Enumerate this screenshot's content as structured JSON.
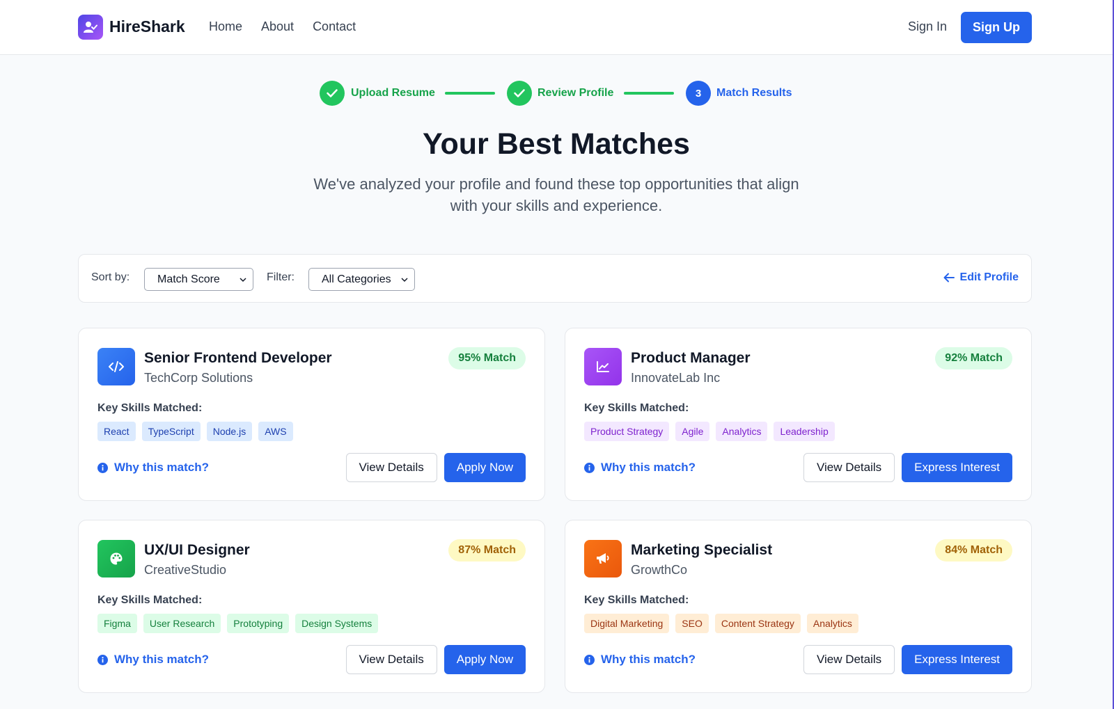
{
  "header": {
    "brand": "HireShark",
    "nav": [
      "Home",
      "About",
      "Contact"
    ],
    "sign_in": "Sign In",
    "sign_up": "Sign Up"
  },
  "steps": [
    {
      "label": "Upload Resume",
      "state": "done"
    },
    {
      "label": "Review Profile",
      "state": "done"
    },
    {
      "label": "Match Results",
      "state": "active",
      "number": "3"
    }
  ],
  "page": {
    "title": "Your Best Matches",
    "subtitle": "We've analyzed your profile and found these top opportunities that align with your skills and experience."
  },
  "toolbar": {
    "sort_label": "Sort by:",
    "sort_value": "Match Score",
    "filter_label": "Filter:",
    "filter_value": "All Categories",
    "edit_profile": "Edit Profile"
  },
  "jobs": [
    {
      "title": "Senior Frontend Developer",
      "company": "TechCorp Solutions",
      "match": "95% Match",
      "icon": "code-icon",
      "skills_label": "Key Skills Matched:",
      "skills": [
        "React",
        "TypeScript",
        "Node.js",
        "AWS"
      ],
      "why": "Why this match?",
      "secondary": "View Details",
      "primary": "Apply Now"
    },
    {
      "title": "Product Manager",
      "company": "InnovateLab Inc",
      "match": "92% Match",
      "icon": "chart-line-icon",
      "skills_label": "Key Skills Matched:",
      "skills": [
        "Product Strategy",
        "Agile",
        "Analytics",
        "Leadership"
      ],
      "why": "Why this match?",
      "secondary": "View Details",
      "primary": "Express Interest"
    },
    {
      "title": "UX/UI Designer",
      "company": "CreativeStudio",
      "match": "87% Match",
      "icon": "palette-icon",
      "skills_label": "Key Skills Matched:",
      "skills": [
        "Figma",
        "User Research",
        "Prototyping",
        "Design Systems"
      ],
      "why": "Why this match?",
      "secondary": "View Details",
      "primary": "Apply Now"
    },
    {
      "title": "Marketing Specialist",
      "company": "GrowthCo",
      "match": "84% Match",
      "icon": "megaphone-icon",
      "skills_label": "Key Skills Matched:",
      "skills": [
        "Digital Marketing",
        "SEO",
        "Content Strategy",
        "Analytics"
      ],
      "why": "Why this match?",
      "secondary": "View Details",
      "primary": "Express Interest"
    }
  ],
  "colors": {
    "accent": "#2563eb",
    "success": "#22c55e",
    "brand_gradient_start": "#4f46e5",
    "brand_gradient_end": "#a855f7"
  }
}
